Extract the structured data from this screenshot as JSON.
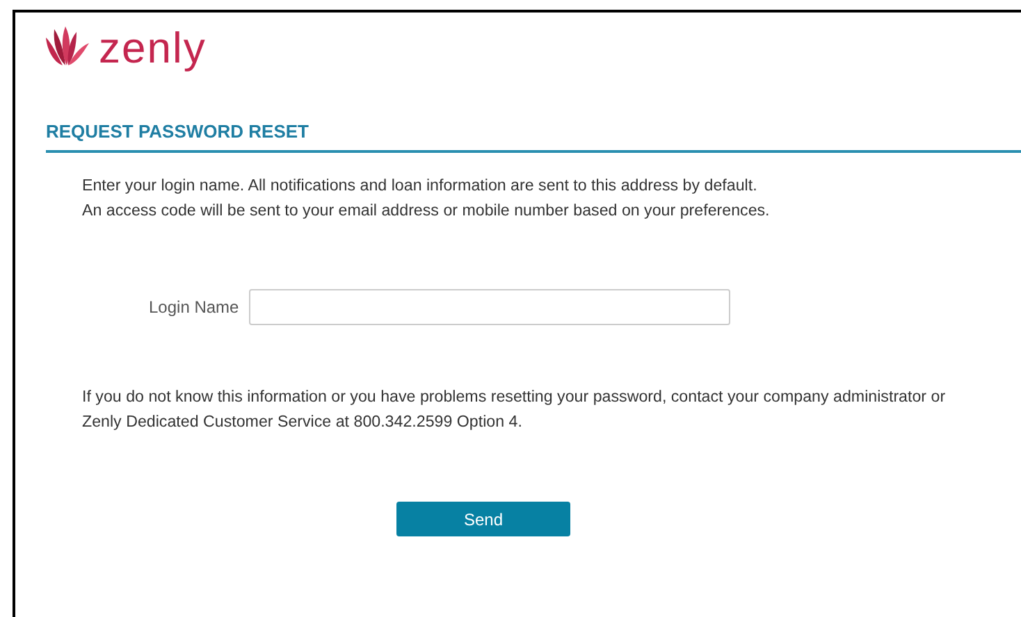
{
  "logo": {
    "name": "zenly"
  },
  "heading": "REQUEST PASSWORD RESET",
  "intro": [
    "Enter your login name. All notifications and loan information are sent to this address by default.",
    "An access code will be sent to your email address or mobile number based on your preferences."
  ],
  "login_field": {
    "label": "Login Name"
  },
  "help": [
    "If you do not know this information or you have problems resetting your password, contact your company administrator or",
    "Zenly Dedicated Customer Service at 800.342.2599 Option 4."
  ],
  "send_button": "Send"
}
